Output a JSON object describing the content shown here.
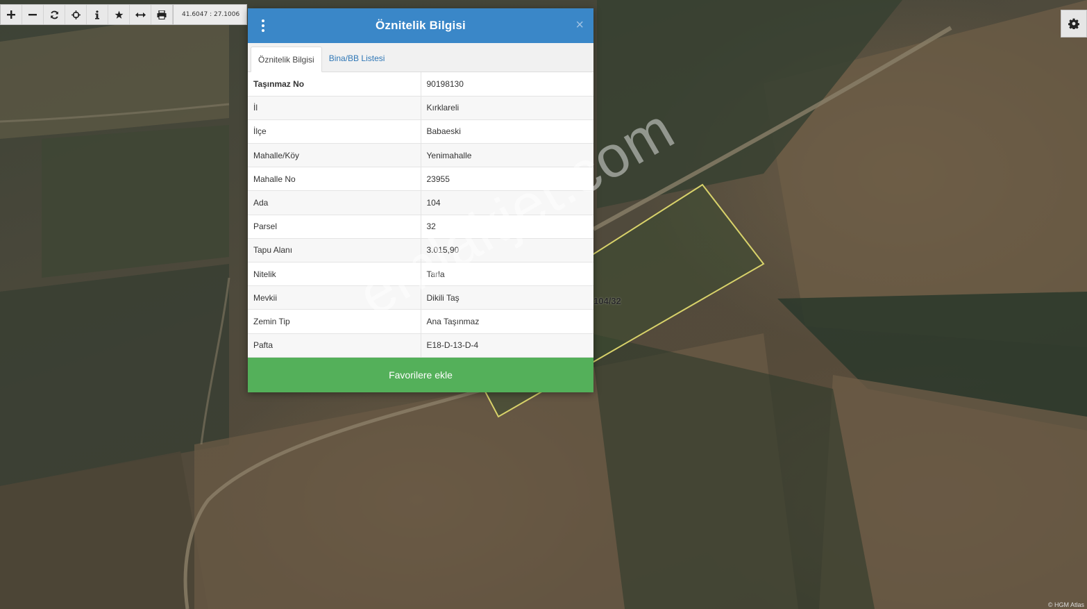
{
  "toolbar": {
    "coordinates": "41.6047 : 27.1006"
  },
  "dialog": {
    "title": "Öznitelik Bilgisi",
    "close_glyph": "×",
    "tabs": [
      {
        "label": "Öznitelik Bilgisi",
        "active": true
      },
      {
        "label": "Bina/BB Listesi",
        "active": false
      }
    ],
    "rows": [
      {
        "key": "Taşınmaz No",
        "value": "90198130"
      },
      {
        "key": "İl",
        "value": "Kırklareli"
      },
      {
        "key": "İlçe",
        "value": "Babaeski"
      },
      {
        "key": "Mahalle/Köy",
        "value": "Yenimahalle"
      },
      {
        "key": "Mahalle No",
        "value": "23955"
      },
      {
        "key": "Ada",
        "value": "104"
      },
      {
        "key": "Parsel",
        "value": "32"
      },
      {
        "key": "Tapu Alanı",
        "value": "3.015,90"
      },
      {
        "key": "Nitelik",
        "value": "Tarla"
      },
      {
        "key": "Mevkii",
        "value": "Dikili Taş"
      },
      {
        "key": "Zemin Tip",
        "value": "Ana Taşınmaz"
      },
      {
        "key": "Pafta",
        "value": "E18-D-13-D-4"
      }
    ],
    "favorite_button": "Favorilere ekle"
  },
  "map": {
    "parcel_label": "104/32",
    "watermark": "emlakjet.com",
    "attribution": "© HGM Atlas"
  },
  "colors": {
    "header": "#3a87c8",
    "favorite": "#54b05a",
    "parcel_outline": "#d8d26a"
  }
}
